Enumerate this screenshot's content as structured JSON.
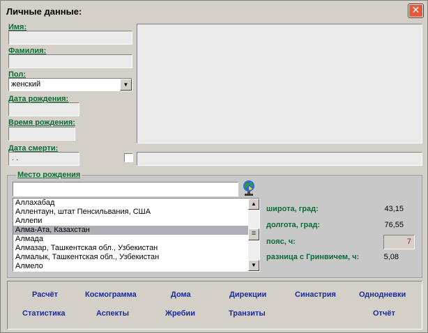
{
  "window": {
    "title": "Личные данные:",
    "close_glyph": "✕"
  },
  "form": {
    "first_name": {
      "label": "Имя:",
      "value": ""
    },
    "last_name": {
      "label": "Фамилия:",
      "value": ""
    },
    "gender": {
      "label": "Пол:",
      "value": "женский"
    },
    "birth_date": {
      "label": "Дата рождения:",
      "value": ""
    },
    "birth_time": {
      "label": "Время рождения:",
      "value": ""
    },
    "death_date": {
      "label": "Дата смерти:",
      "value": ". ."
    },
    "notes": "",
    "death_comment": ""
  },
  "birthplace": {
    "group_label": "Место рождения",
    "search_value": "",
    "search_icon": "globe-icon",
    "cities": [
      "Аллахабад",
      "Аллентаун, штат Пенсильвания, США",
      "Аллепи",
      "Алма-Ата, Казахстан",
      "Алмада",
      "Алмазар, Ташкентская обл., Узбекистан",
      "Алмалык, Ташкентская обл., Узбекистан",
      "Алмело"
    ],
    "selected_index": 3,
    "latitude": {
      "label": "широта, град:",
      "value": "43,15"
    },
    "longitude": {
      "label": "долгота, град:",
      "value": "76,55"
    },
    "timezone": {
      "label": "пояс, ч:",
      "value": "7"
    },
    "gmt_diff": {
      "label": "разница с Гринвичем, ч:",
      "value": "5,08"
    }
  },
  "actions": {
    "row1": [
      "Расчёт",
      "Космограмма",
      "Дома",
      "Дирекции",
      "Синастрия",
      "Однодневки"
    ],
    "row2": [
      "Статистика",
      "Аспекты",
      "Жребии",
      "Транзиты",
      "Отчёт"
    ]
  },
  "colors": {
    "label_green": "#0a6a38",
    "action_blue": "#1a2a9a",
    "timezone_red": "#8b1a1a"
  }
}
